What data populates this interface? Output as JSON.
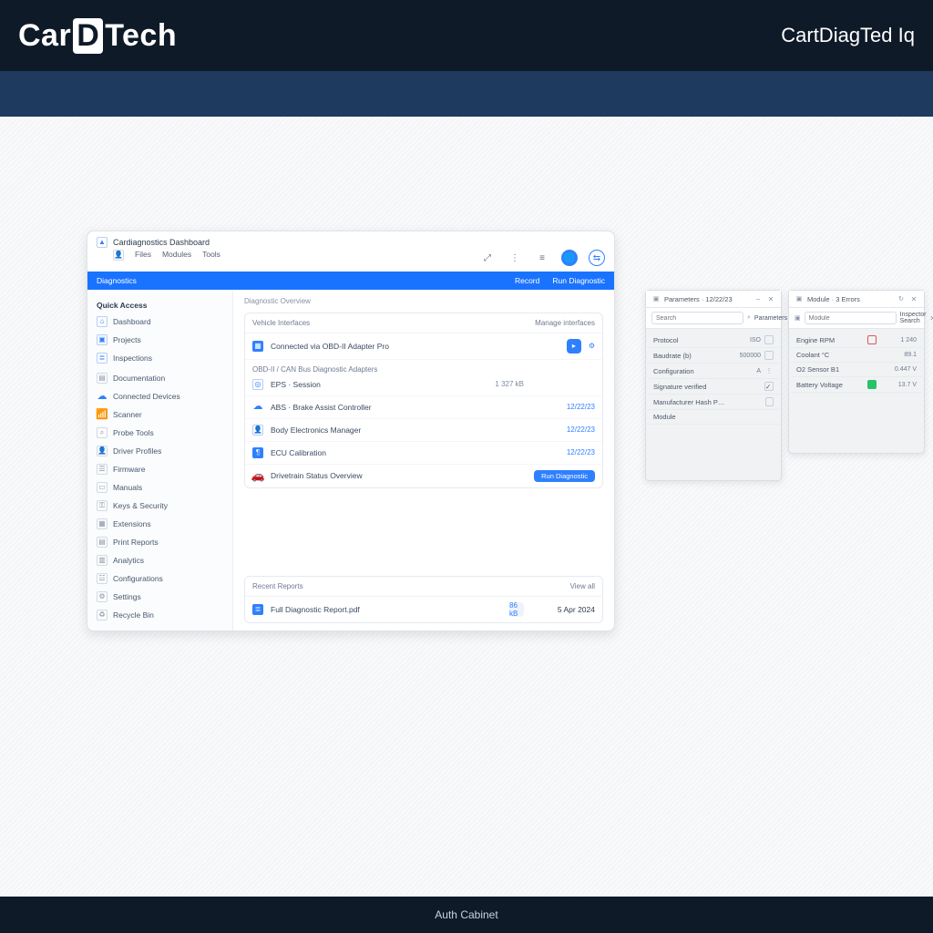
{
  "brand": {
    "logo_left": "Car",
    "logo_d": "D",
    "logo_right": "Tech",
    "tagline": "CartDiagTed Iq"
  },
  "app": {
    "title": "Cardiagnostics Dashboard",
    "menus": [
      "Files",
      "Modules",
      "Tools"
    ],
    "toolbar_icons": {
      "pin": "⤢",
      "more": "⋮",
      "menu": "≡",
      "globe": "🌐",
      "sync": "⇆"
    },
    "strip": {
      "left": "Diagnostics",
      "right1": "Record",
      "right2": "Run Diagnostic"
    },
    "sidebar": {
      "group1_title": "Quick Access",
      "group1": [
        {
          "icon": "home",
          "label": "Dashboard"
        },
        {
          "icon": "folder",
          "label": "Projects"
        },
        {
          "icon": "list",
          "label": "Inspections"
        }
      ],
      "group2": [
        {
          "icon": "doc",
          "label": "Documentation"
        },
        {
          "icon": "cloud",
          "label": "Connected Devices"
        },
        {
          "icon": "antenna",
          "label": "Scanner"
        },
        {
          "icon": "search",
          "label": "Probe Tools"
        },
        {
          "icon": "person",
          "label": "Driver Profiles"
        },
        {
          "icon": "stack",
          "label": "Firmware"
        },
        {
          "icon": "book",
          "label": "Manuals"
        },
        {
          "icon": "keys",
          "label": "Keys & Security"
        },
        {
          "icon": "grid",
          "label": "Extensions"
        },
        {
          "icon": "doc2",
          "label": "Print Reports"
        },
        {
          "icon": "report",
          "label": "Analytics"
        },
        {
          "icon": "cfg",
          "label": "Configurations"
        },
        {
          "icon": "gear",
          "label": "Settings"
        },
        {
          "icon": "trash",
          "label": "Recycle Bin"
        }
      ]
    },
    "main": {
      "section_label": "Diagnostic Overview",
      "card1": {
        "head_left": "Vehicle Interfaces",
        "head_right": "Manage interfaces",
        "featured": {
          "label": "Connected via OBD-II Adapter Pro",
          "action_icon": "⚙"
        },
        "subhead": "OBD-II / CAN Bus Diagnostic Adapters",
        "rows": [
          {
            "icon": "target",
            "label": "EPS · Session",
            "meta": "1 327 kB",
            "action": ""
          },
          {
            "icon": "cloud",
            "label": "ABS · Brake Assist Controller",
            "meta": "",
            "action": "12/22/23"
          },
          {
            "icon": "person",
            "label": "Body Electronics Manager",
            "meta": "",
            "action": "12/22/23"
          },
          {
            "icon": "chip",
            "label": "ECU Calibration",
            "meta": "",
            "action": "12/22/23"
          },
          {
            "icon": "car",
            "label": "Drivetrain Status Overview",
            "meta": "",
            "action_pill": "Run Diagnostic"
          }
        ]
      },
      "card2": {
        "head_left": "Recent Reports",
        "head_right": "View all",
        "rows": [
          {
            "icon": "pdf",
            "label": "Full Diagnostic Report.pdf",
            "meta": "86 kB",
            "date": "5 Apr 2024"
          }
        ]
      }
    }
  },
  "panel1": {
    "title": "Parameters · 12/22/23",
    "search_placeholder": "Search",
    "btn": "Parameters",
    "rows": [
      {
        "label": "Protocol",
        "val": "ISO",
        "flag": ""
      },
      {
        "label": "Baudrate (b)",
        "val": "500000",
        "flag": ""
      },
      {
        "label": "Configuration",
        "val": "A",
        "flag": ""
      },
      {
        "label": "Signature verified",
        "val": "",
        "flag": "check"
      },
      {
        "label": "Manufacturer Hash Pending",
        "val": "",
        "flag": "box"
      },
      {
        "label": "Module",
        "val": "",
        "flag": ""
      }
    ]
  },
  "panel2": {
    "title": "Module · 3 Errors",
    "search_placeholder": "Module",
    "btn": "Inspector Search",
    "rows": [
      {
        "label": "Engine RPM",
        "val": "1 240",
        "flag": "red"
      },
      {
        "label": "Coolant °C",
        "val": "89.1",
        "flag": ""
      },
      {
        "label": "O2 Sensor B1",
        "val": "0.447 V",
        "flag": ""
      },
      {
        "label": "Battery Voltage",
        "val": "13.7 V",
        "flag": "green"
      }
    ]
  },
  "footer": "Auth Cabinet"
}
